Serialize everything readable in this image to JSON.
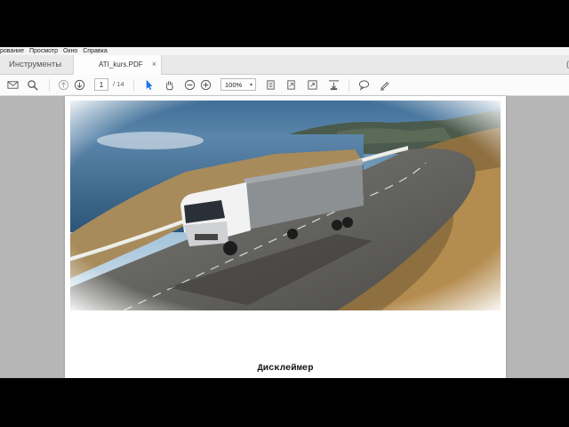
{
  "menu": [
    "рование",
    "Просмотр",
    "Окно",
    "Справка"
  ],
  "tabs": {
    "tools": "Инструменты",
    "document": "ATI_kurs.PDF",
    "close": "×",
    "right_fragment": "("
  },
  "toolbar": {
    "page_current": "1",
    "page_total": "/ 14",
    "zoom": "100%",
    "zoom_caret": "▾"
  },
  "page": {
    "heading": "Дисклеймер"
  },
  "colors": {
    "accent_select": "#1a73e8",
    "workspace": "#b6b6b6"
  }
}
